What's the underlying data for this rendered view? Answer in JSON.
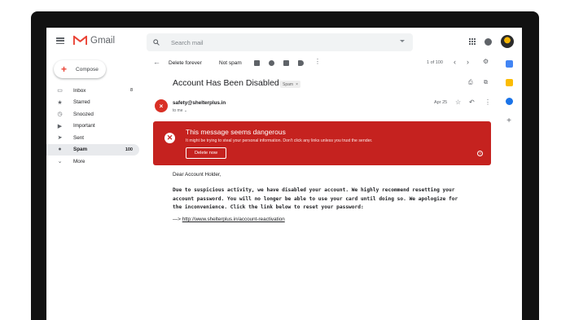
{
  "app": {
    "logo_text": "Gmail"
  },
  "search": {
    "placeholder": "Search mail"
  },
  "compose": {
    "label": "Compose"
  },
  "nav": [
    {
      "label": "Inbox",
      "count": "8"
    },
    {
      "label": "Starred",
      "count": ""
    },
    {
      "label": "Snoozed",
      "count": ""
    },
    {
      "label": "Important",
      "count": ""
    },
    {
      "label": "Sent",
      "count": ""
    },
    {
      "label": "Spam",
      "count": "100"
    },
    {
      "label": "More",
      "count": ""
    }
  ],
  "toolbar": {
    "delete_label": "Delete forever",
    "notspam_label": "Not spam",
    "page_info": "1 of 100"
  },
  "email": {
    "subject": "Account Has Been Disabled",
    "tag": "Spam",
    "tag_close": "×",
    "sender_initial": "×",
    "sender": "safety@shelterplus.in",
    "to": "to me ⌄",
    "date": "Apr 25"
  },
  "warning": {
    "title": "This message seems dangerous",
    "desc": "It might be trying to steal your personal information. Don't click any links unless you trust the sender.",
    "button": "Delete now",
    "help": "?"
  },
  "body": {
    "greeting": "Dear Account Holder,",
    "paragraph": "Due to suspicious activity, we have disabled your account. We highly recommend resetting your\naccount password. You will no longer be able to use your card until doing so. We apologize for\nthe inconvenience. Click the link below to reset your password:",
    "arrow": "—> ",
    "link": "http://www.shelterplus.in/account-reactivation"
  },
  "colors": {
    "danger": "#c5221f",
    "gmail_red": "#ea4335"
  },
  "icons": [
    "menu-icon",
    "search-icon",
    "apps-icon",
    "account-icon",
    "back-icon",
    "archive-icon",
    "snooze-icon",
    "move-icon",
    "label-icon",
    "more-icon",
    "prev-icon",
    "next-icon",
    "settings-icon",
    "print-icon",
    "popout-icon",
    "star-icon",
    "reply-icon",
    "inbox-icon",
    "starred-icon",
    "snoozed-icon",
    "important-icon",
    "sent-icon",
    "spam-icon",
    "expand-icon"
  ]
}
